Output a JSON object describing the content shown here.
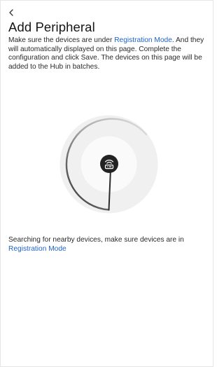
{
  "header": {
    "back_icon": "chevron-left-icon",
    "title": "Add Peripheral"
  },
  "intro": {
    "text_before_link": "Make sure the devices are under ",
    "link": "Registration Mode",
    "text_after_link": ". And they will automatically displayed on this page. Complete the configuration and click Save. The devices on this page will be added to the Hub in batches."
  },
  "scanner": {
    "center_icon": "router-signal-icon",
    "colors": {
      "outer_ring": "#f0f0f0",
      "inner_ring": "#fafafa",
      "sweep_light": "#a9a9a9",
      "sweep_dark": "#2c2c2c",
      "center": "#222222"
    }
  },
  "status": {
    "text_before_link": "Searching for nearby devices, make sure devices are in ",
    "link": "Registration Mode"
  },
  "colors": {
    "link": "#1f63c6",
    "text": "#2a2a2a",
    "background": "#ffffff"
  }
}
